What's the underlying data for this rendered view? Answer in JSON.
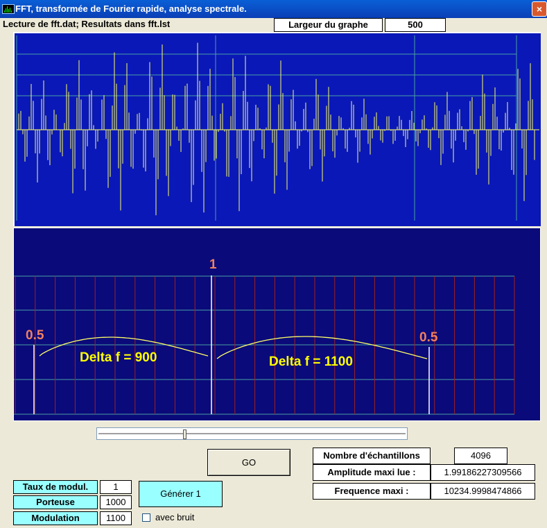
{
  "window": {
    "title": "FFT, transformée de Fourier rapide, analyse spectrale.",
    "close_glyph": "×",
    "app_icon": "spectrum-icon"
  },
  "info": {
    "file_label": "Lecture de fft.dat; Resultats dans fft.lst"
  },
  "graph_width": {
    "label": "Largeur du graphe",
    "value": "500"
  },
  "spectrum": {
    "peak_label": "1",
    "left_label": "0.5",
    "right_label": "0.5",
    "left_delta": "Delta f = 900",
    "right_delta": "Delta f = 1100"
  },
  "controls": {
    "go_label": "GO",
    "generate_label": "Générer 1",
    "noise_label": "avec bruit",
    "slider_value": 0.28
  },
  "params": [
    {
      "label": "Taux de modul.",
      "value": "1"
    },
    {
      "label": "Porteuse",
      "value": "1000"
    },
    {
      "label": "Modulation",
      "value": "1100"
    }
  ],
  "results": [
    {
      "label": "Nombre d'échantillons",
      "value": "4096"
    },
    {
      "label": "Amplitude maxi lue :",
      "value": "1.99186227309566"
    },
    {
      "label": "Frequence maxi :",
      "value": "10234.9998474866"
    }
  ],
  "colors": {
    "wave_bg": "#0a18b8",
    "spec_bg": "#0a0a7a",
    "signal": "#ffff66",
    "label_orange": "#f08060",
    "label_yellow": "#ffff00",
    "grid": "#4aa0a0",
    "spec_lines": "#a02020"
  }
}
